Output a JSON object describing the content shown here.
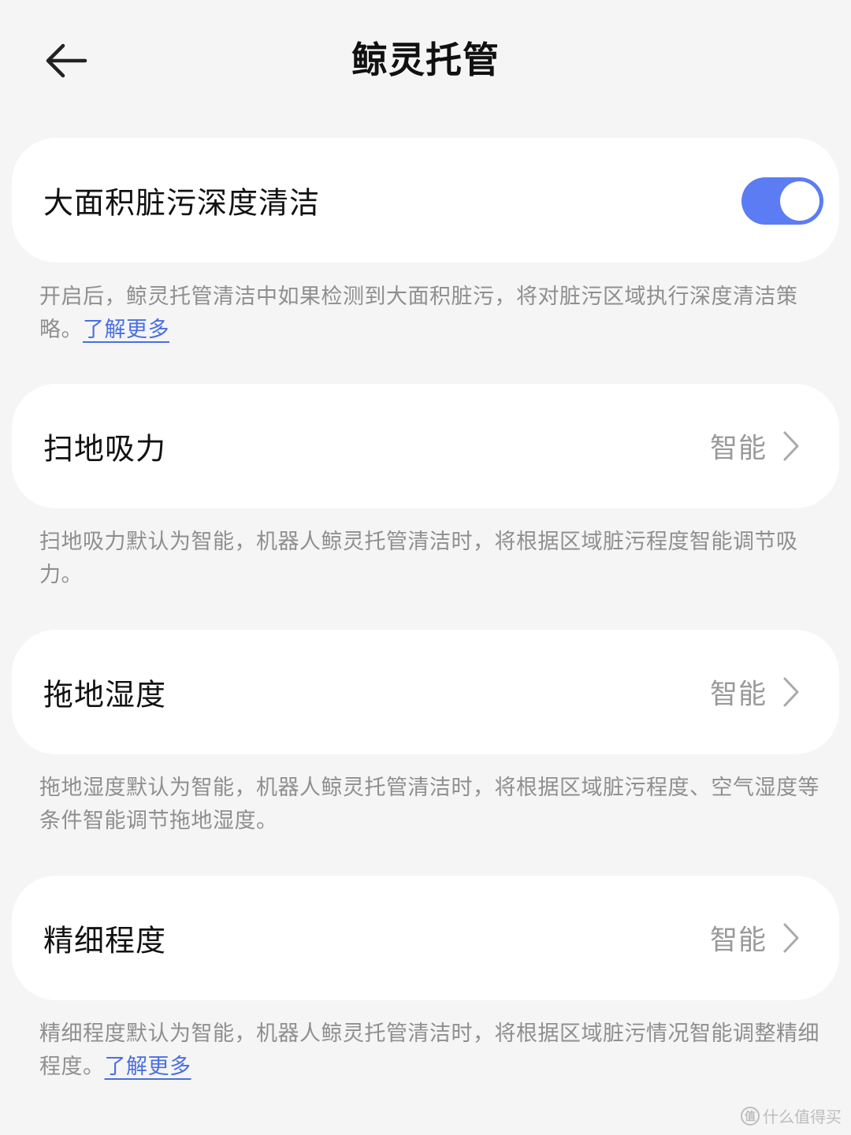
{
  "header": {
    "title": "鲸灵托管",
    "back_icon": "arrow-left-icon"
  },
  "deep_clean": {
    "label": "大面积脏污深度清洁",
    "toggle_on": true,
    "toggle_color": "#5b7cf2",
    "description": "开启后，鲸灵托管清洁中如果检测到大面积脏污，将对脏污区域执行深度清洁策略。",
    "link": "了解更多"
  },
  "suction": {
    "label": "扫地吸力",
    "value": "智能",
    "description": "扫地吸力默认为智能，机器人鲸灵托管清洁时，将根据区域脏污程度智能调节吸力。"
  },
  "mop_humidity": {
    "label": "拖地湿度",
    "value": "智能",
    "description": "拖地湿度默认为智能，机器人鲸灵托管清洁时，将根据区域脏污程度、空气湿度等条件智能调节拖地湿度。"
  },
  "fineness": {
    "label": "精细程度",
    "value": "智能",
    "description": "精细程度默认为智能，机器人鲸灵托管清洁时，将根据区域脏污情况智能调整精细程度。",
    "link": "了解更多"
  },
  "watermark": {
    "logo_text": "值",
    "text": "什么值得买"
  }
}
